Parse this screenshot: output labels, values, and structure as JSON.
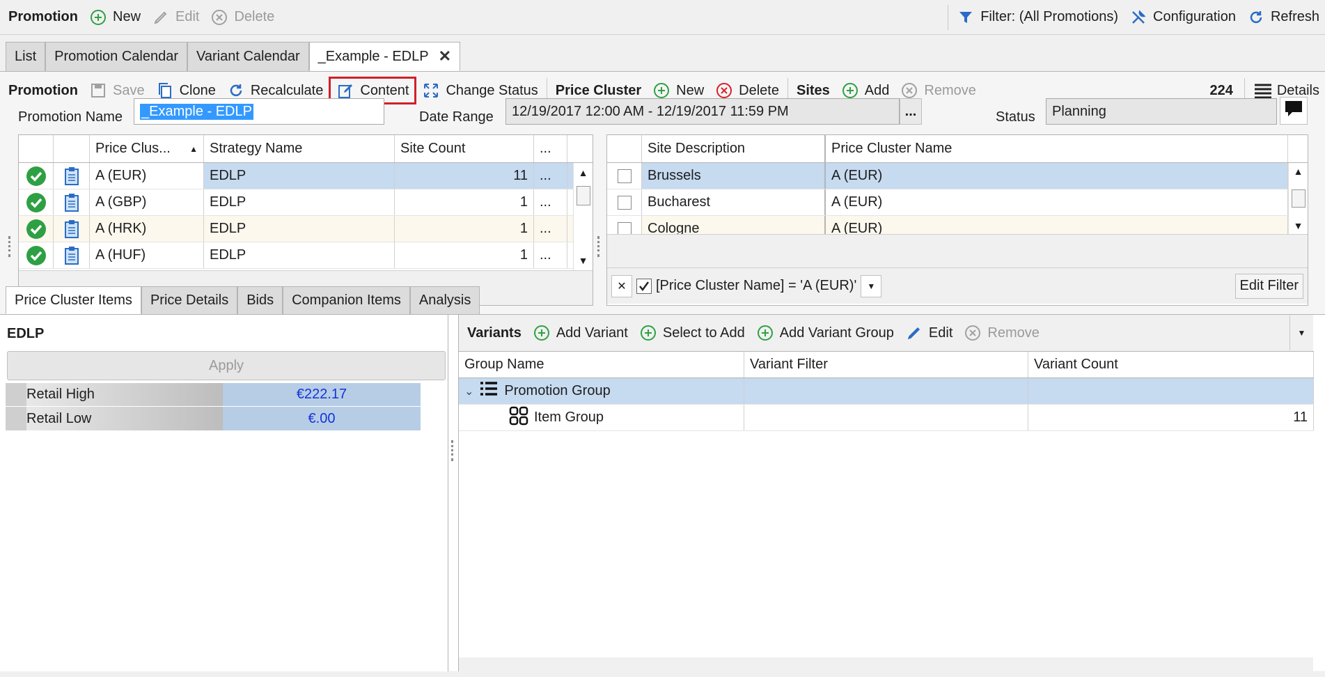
{
  "top_toolbar": {
    "title": "Promotion",
    "new_label": "New",
    "edit_label": "Edit",
    "delete_label": "Delete",
    "filter_label": "Filter: (All Promotions)",
    "configuration_label": "Configuration",
    "refresh_label": "Refresh"
  },
  "tabs": [
    {
      "label": "List"
    },
    {
      "label": "Promotion Calendar"
    },
    {
      "label": "Variant Calendar"
    },
    {
      "label": "_Example - EDLP"
    }
  ],
  "promo_toolbar": {
    "promotion_title": "Promotion",
    "save_label": "Save",
    "clone_label": "Clone",
    "recalculate_label": "Recalculate",
    "content_label": "Content",
    "change_status_label": "Change Status",
    "price_cluster_title": "Price Cluster",
    "pc_new_label": "New",
    "pc_delete_label": "Delete",
    "sites_title": "Sites",
    "add_label": "Add",
    "remove_label": "Remove",
    "count": "224",
    "details_label": "Details"
  },
  "form": {
    "promotion_name_label": "Promotion Name",
    "promotion_name_value": "_Example - EDLP",
    "date_range_label": "Date Range",
    "date_range_value": "12/19/2017 12:00 AM - 12/19/2017 11:59 PM",
    "date_range_button": "...",
    "status_label": "Status",
    "status_value": "Planning"
  },
  "cluster_grid": {
    "headers": {
      "price_cluster": "Price Clus...",
      "strategy": "Strategy Name",
      "site_count": "Site Count",
      "more": "..."
    },
    "rows": [
      {
        "cluster": "A (EUR)",
        "strategy": "EDLP",
        "count": "11",
        "more": "..."
      },
      {
        "cluster": "A (GBP)",
        "strategy": "EDLP",
        "count": "1",
        "more": "..."
      },
      {
        "cluster": "A (HRK)",
        "strategy": "EDLP",
        "count": "1",
        "more": "..."
      },
      {
        "cluster": "A (HUF)",
        "strategy": "EDLP",
        "count": "1",
        "more": "..."
      }
    ]
  },
  "sites_grid": {
    "headers": {
      "site_description": "Site Description",
      "price_cluster_name": "Price Cluster Name"
    },
    "rows": [
      {
        "site": "Brussels",
        "cluster": "A (EUR)"
      },
      {
        "site": "Bucharest",
        "cluster": "A (EUR)"
      },
      {
        "site": "Cologne",
        "cluster": "A (EUR)"
      }
    ],
    "filter_text": "[Price Cluster Name] = 'A (EUR)'",
    "edit_filter_label": "Edit Filter"
  },
  "bottom_tabs": [
    {
      "label": "Price Cluster Items"
    },
    {
      "label": "Price Details"
    },
    {
      "label": "Bids"
    },
    {
      "label": "Companion Items"
    },
    {
      "label": "Analysis"
    }
  ],
  "strategy_panel": {
    "title": "EDLP",
    "apply_label": "Apply",
    "rows": [
      {
        "label": "Retail High",
        "value": "€222.17"
      },
      {
        "label": "Retail Low",
        "value": "€.00"
      }
    ]
  },
  "variants": {
    "title": "Variants",
    "add_variant_label": "Add Variant",
    "select_to_add_label": "Select to Add",
    "add_variant_group_label": "Add Variant Group",
    "edit_label": "Edit",
    "remove_label": "Remove",
    "headers": {
      "group_name": "Group Name",
      "variant_filter": "Variant Filter",
      "variant_count": "Variant Count"
    },
    "rows": [
      {
        "name": "Promotion Group",
        "filter": "",
        "count": ""
      },
      {
        "name": "Item Group",
        "filter": "",
        "count": "11"
      }
    ]
  },
  "colors": {
    "accent_green": "#2ea043",
    "delete_red": "#d9202a",
    "selection": "#c6daf0",
    "highlight_border": "#d0202a",
    "link_blue": "#1a6fd0"
  }
}
